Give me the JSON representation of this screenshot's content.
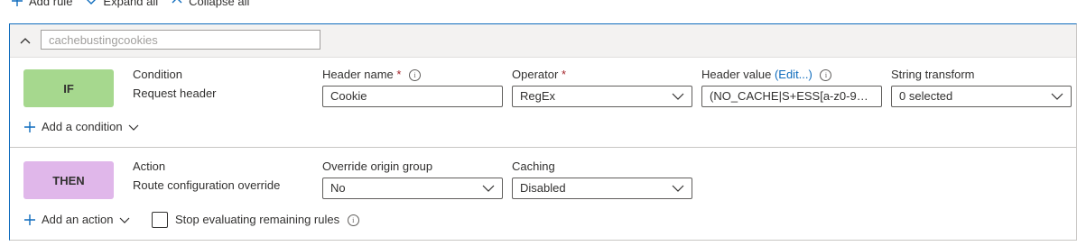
{
  "toolbar": {
    "add_rule": "Add rule",
    "expand_all": "Expand all",
    "collapse_all": "Collapse all"
  },
  "rule": {
    "name_placeholder": "cachebustingcookies",
    "condition": {
      "badge": "IF",
      "type_label": "Condition",
      "type_value": "Request header",
      "header_name_label": "Header name",
      "header_name_value": "Cookie",
      "operator_label": "Operator",
      "operator_value": "RegEx",
      "header_value_label": "Header value",
      "header_value_edit": "(Edit...)",
      "header_value_value": "(NO_CACHE|S+ESS[a-z0-9]+|P...",
      "string_transform_label": "String transform",
      "string_transform_value": "0 selected",
      "add_condition": "Add a condition",
      "required_marker": "*"
    },
    "action": {
      "badge": "THEN",
      "type_label": "Action",
      "type_value": "Route configuration override",
      "override_origin_label": "Override origin group",
      "override_origin_value": "No",
      "caching_label": "Caching",
      "caching_value": "Disabled",
      "add_action": "Add an action",
      "stop_evaluating": "Stop evaluating remaining rules"
    }
  },
  "colors": {
    "accent": "#0f6cbd",
    "if_badge": "#a6d88e",
    "then_badge": "#e0b7ea"
  }
}
